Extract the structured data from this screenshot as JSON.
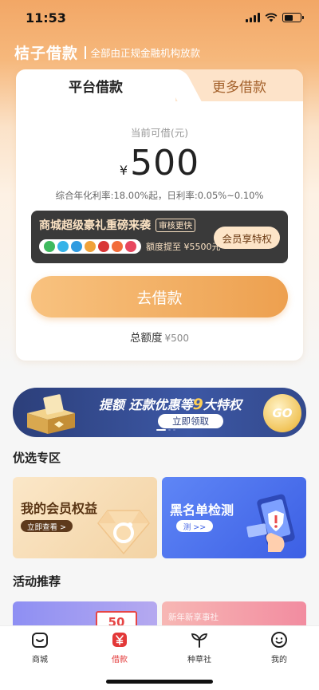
{
  "status_bar": {
    "time": "11:53"
  },
  "brand": {
    "name": "桔子借款",
    "slogan": "全部由正规金融机构放款"
  },
  "loan_card": {
    "tabs": [
      {
        "label": "平台借款",
        "active": true
      },
      {
        "label": "更多借款",
        "active": false
      }
    ],
    "available_label": "当前可借(元)",
    "currency_symbol": "¥",
    "available_amount": "500",
    "rate_text": "综合年化利率:18.00%起，日利率:0.05%~0.10%",
    "promo": {
      "title": "商城超级豪礼重磅来袭",
      "tag": "审核更快",
      "subtitle": "额度提至 ¥5500元",
      "button": "会员享特权"
    },
    "borrow_button": "去借款",
    "total_label": "总额度",
    "total_value": "¥500"
  },
  "banner": {
    "title_prefix": "提额 还款优惠等",
    "title_number": "9",
    "title_suffix": "大特权",
    "button": "立即领取",
    "badge": "GO"
  },
  "sections": {
    "featured_title": "优选专区",
    "activity_title": "活动推荐"
  },
  "featured": {
    "member": {
      "title": "我的会员权益",
      "button": "立即查看 >"
    },
    "blacklist": {
      "title": "黑名单检测",
      "button": "测 >>"
    }
  },
  "activities": {
    "left_badge": "50",
    "right_text": "新年新享事社"
  },
  "tabbar": {
    "items": [
      {
        "label": "商城",
        "icon": "mall-icon",
        "active": false
      },
      {
        "label": "借款",
        "icon": "loan-yen-icon",
        "active": true
      },
      {
        "label": "种草社",
        "icon": "sprout-icon",
        "active": false
      },
      {
        "label": "我的",
        "icon": "profile-icon",
        "active": false
      }
    ]
  },
  "colors": {
    "accent": "#eda04f",
    "brand_orange": "#f2a766",
    "active_tab": "#e33838",
    "banner_blue": "#2c3f7a"
  }
}
